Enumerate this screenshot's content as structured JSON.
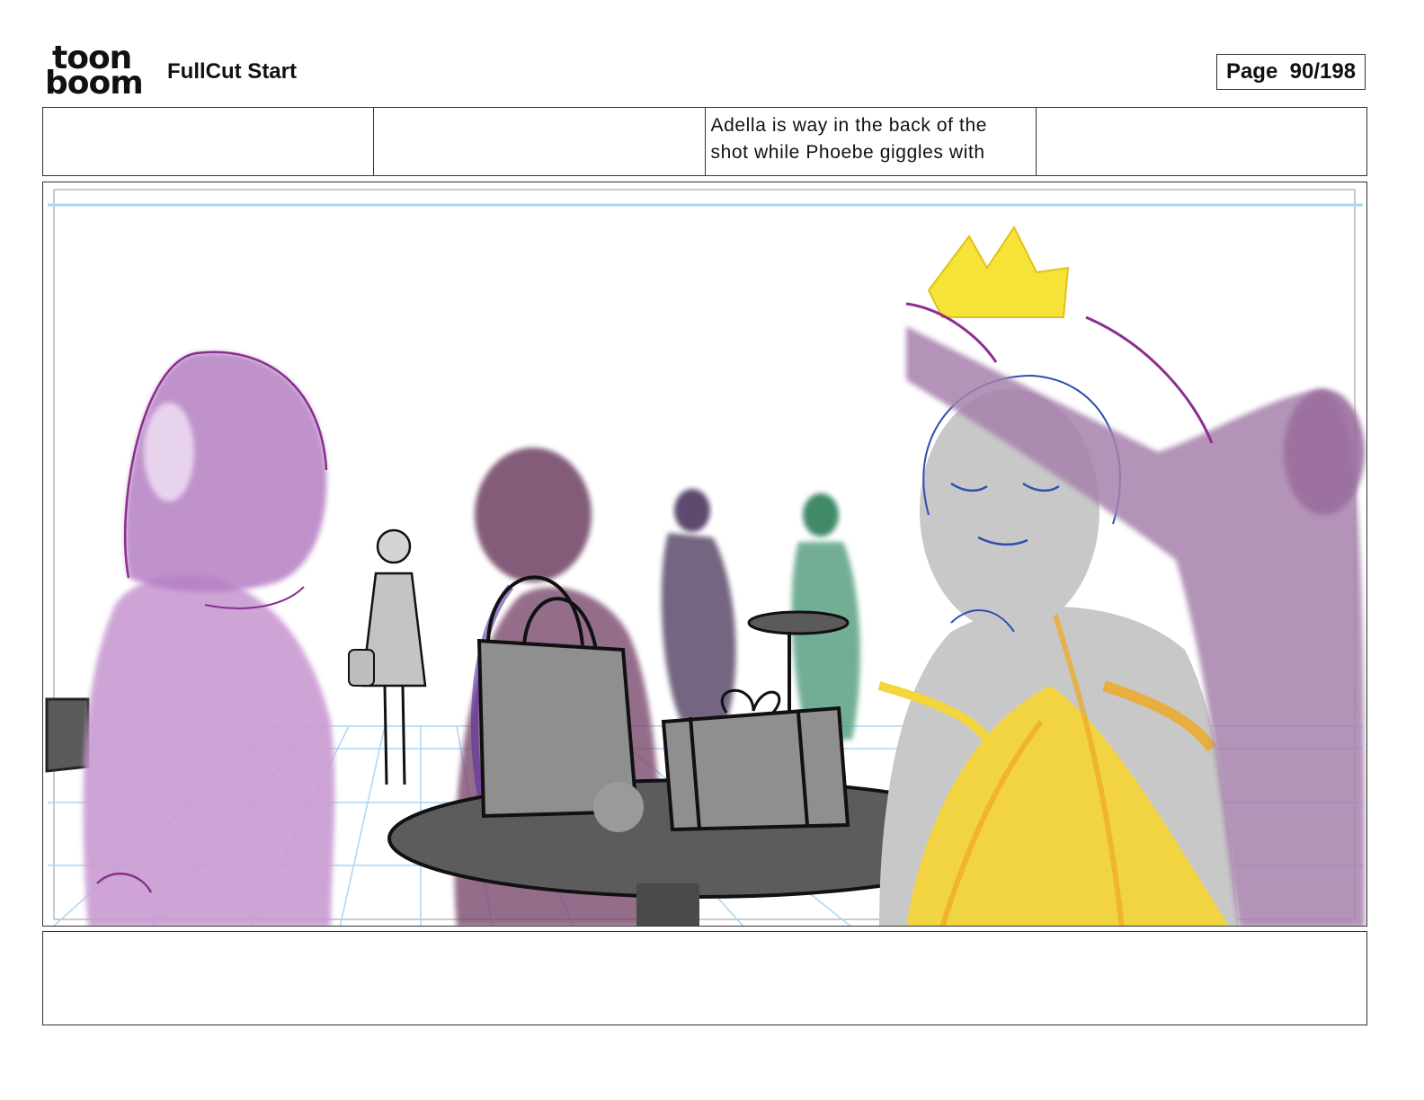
{
  "header": {
    "logo_top": "toon",
    "logo_bottom": "boom",
    "title": "FullCut Start",
    "page_label": "Page",
    "page_number": "90/198"
  },
  "caption_row": {
    "cells": [
      "",
      "",
      "Adella is way in the back of the shot while Phoebe giggles with",
      ""
    ]
  },
  "notes": "",
  "colors": {
    "lilac": "#b57fc3",
    "plum": "#7a4a6e",
    "gold": "#f4d53b",
    "grey": "#9a9a9a",
    "guide_blue": "#a9d6f5"
  }
}
